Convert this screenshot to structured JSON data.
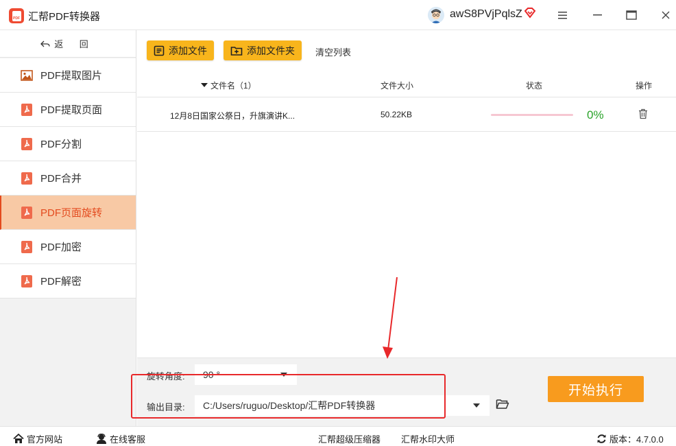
{
  "app": {
    "title": "汇帮PDF转换器",
    "user_name": "awS8PVjPqlsZ"
  },
  "sidebar": {
    "back_label": "返 回",
    "items": [
      {
        "label": "PDF提取图片",
        "icon": "image-icon"
      },
      {
        "label": "PDF提取页面",
        "icon": "pdf-icon"
      },
      {
        "label": "PDF分割",
        "icon": "pdf-icon"
      },
      {
        "label": "PDF合并",
        "icon": "pdf-icon"
      },
      {
        "label": "PDF页面旋转",
        "icon": "pdf-icon",
        "active": true
      },
      {
        "label": "PDF加密",
        "icon": "pdf-icon"
      },
      {
        "label": "PDF解密",
        "icon": "pdf-icon"
      }
    ]
  },
  "toolbar": {
    "add_file": "添加文件",
    "add_folder": "添加文件夹",
    "clear_list": "清空列表"
  },
  "table": {
    "headers": {
      "filename": "文件名（1）",
      "size": "文件大小",
      "status": "状态",
      "action": "操作"
    },
    "rows": [
      {
        "filename": "12月8日国家公祭日，升旗演讲K...",
        "size": "50.22KB",
        "progress_percent": 0,
        "percent_label": "0%"
      }
    ]
  },
  "settings": {
    "rotate_label": "旋转角度:",
    "rotate_value": "90 °",
    "output_label": "输出目录:",
    "output_value": "C:/Users/ruguo/Desktop/汇帮PDF转换器",
    "start_button": "开始执行"
  },
  "footer": {
    "website": "官方网站",
    "support": "在线客服",
    "compressor": "汇帮超级压缩器",
    "watermark": "汇帮水印大师",
    "version": "版本：4.7.0.0"
  },
  "colors": {
    "accent_yellow": "#f8b51c",
    "start_orange": "#f89b1e",
    "active_bg": "#f8c9a5",
    "active_text": "#e34a1e",
    "annotation_red": "#e8282a",
    "percent_green": "#2aa32a"
  }
}
